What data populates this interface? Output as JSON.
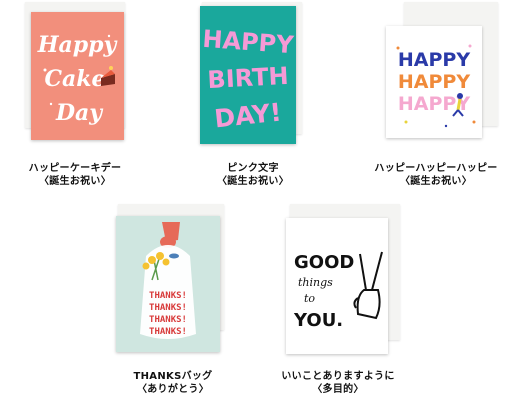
{
  "cards": [
    {
      "name": "ハッピーケーキデー",
      "category": "〈誕生お祝い〉",
      "art_text": [
        "Happy",
        "Cake",
        "Day"
      ],
      "bg": "#f28f7c"
    },
    {
      "name": "ピンク文字",
      "category": "〈誕生お祝い〉",
      "art_text": [
        "HAPPY",
        "BIRTH",
        "DAY!"
      ],
      "bg": "#1aa89c"
    },
    {
      "name": "ハッピーハッピーハッピー",
      "category": "〈誕生お祝い〉",
      "art_text": [
        "HAPPY",
        "HAPPY",
        "HAPPY"
      ],
      "bg": "#ffffff"
    },
    {
      "name": "THANKSバッグ",
      "category": "〈ありがとう〉",
      "art_text": [
        "THANKS!",
        "THANKS!",
        "THANKS!",
        "THANKS!"
      ],
      "bg": "#cfe6e0"
    },
    {
      "name": "いいことありますように",
      "category": "〈多目的〉",
      "art_text": [
        "GOOD",
        "things",
        "to",
        "YOU."
      ],
      "bg": "#ffffff"
    }
  ]
}
